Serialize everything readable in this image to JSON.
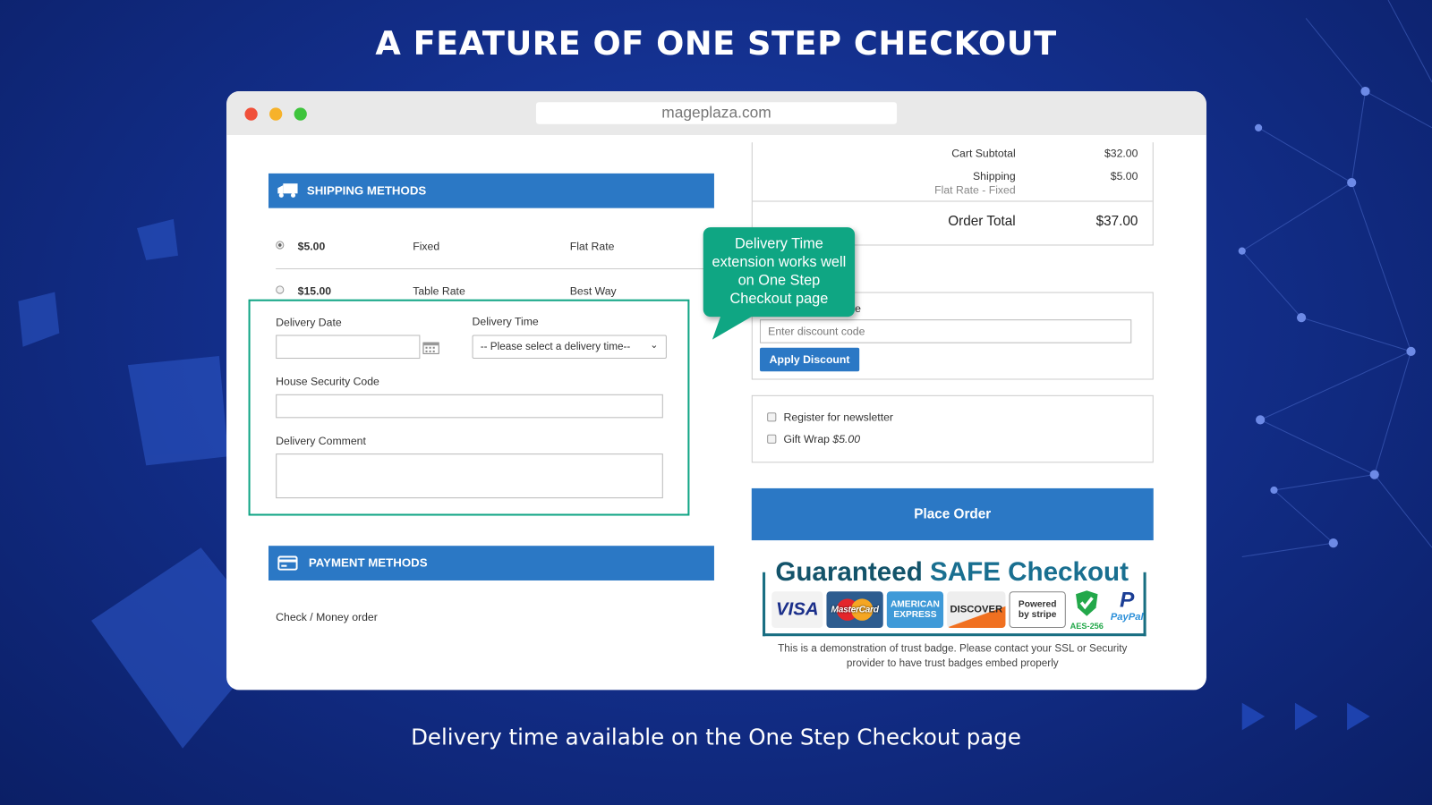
{
  "page": {
    "title": "A FEATURE OF ONE STEP CHECKOUT",
    "subtitle": "Delivery time available on the One Step Checkout page"
  },
  "browser": {
    "url": "mageplaza.com"
  },
  "shipping": {
    "header": "SHIPPING METHODS",
    "icon": "truck-icon",
    "options": [
      {
        "price": "$5.00",
        "method": "Fixed",
        "carrier": "Flat Rate",
        "selected": true
      },
      {
        "price": "$15.00",
        "method": "Table Rate",
        "carrier": "Best Way",
        "selected": false
      }
    ]
  },
  "delivery": {
    "date_label": "Delivery Date",
    "date_value": "",
    "time_label": "Delivery Time",
    "time_value": "-- Please select a delivery time--",
    "security_label": "House Security Code",
    "security_value": "",
    "comment_label": "Delivery Comment",
    "comment_value": "",
    "accent": "#11a585"
  },
  "payment": {
    "header": "PAYMENT METHODS",
    "icon": "credit-card-icon",
    "option": "Check / Money order"
  },
  "summary": {
    "subtotal_label": "Cart Subtotal",
    "subtotal": "$32.00",
    "shipping_label": "Shipping",
    "shipping_sub": "Flat Rate - Fixed",
    "shipping": "$5.00",
    "total_label": "Order Total",
    "total": "$37.00"
  },
  "discount": {
    "label_visible": "e",
    "placeholder": "Enter discount code",
    "button": "Apply Discount"
  },
  "options": {
    "newsletter": "Register for newsletter",
    "giftwrap": "Gift Wrap",
    "giftwrap_price": "$5.00"
  },
  "place_order": "Place Order",
  "trust": {
    "title_a": "Guaranteed",
    "title_b": "SAFE Checkout",
    "badges": [
      "VISA",
      "MasterCard",
      "AMERICAN EXPRESS",
      "DISCOVER",
      "Powered by stripe",
      "AES-256",
      "PayPal"
    ],
    "note": "This is a demonstration of trust badge. Please contact your SSL or Security provider to have trust badges embed properly"
  },
  "callout": "Delivery Time extension works well on One Step Checkout page",
  "colors": {
    "brand_blue": "#2b78c5",
    "callout": "#0fa683",
    "background": "#132f8c"
  }
}
